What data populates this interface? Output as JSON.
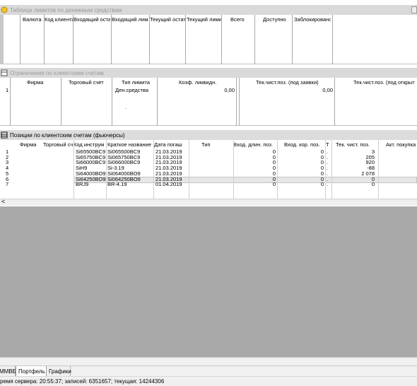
{
  "limits_window": {
    "title": "Таблица лимитов по денежным средствам",
    "columns": [
      "Валюта",
      "Код клиента",
      "Входящий остат",
      "Входящий лими",
      "Текущий остат",
      "Текущий лими",
      "Всего",
      "Доступно",
      "Заблокировано"
    ]
  },
  "restrictions_window": {
    "title": "Ограничения по клиентским счетам",
    "columns": [
      "Фирма",
      "Торговый счет",
      "Тип лимита",
      "Коэф. ликвидн.",
      "Тек.чист.поз. (под заявки)",
      "Тек.чист.поз. (под открыт"
    ],
    "row": {
      "num": "1",
      "limit_type": "Ден.средства",
      "coef": "0,00",
      "net_pos_orders": "0,00",
      "dot": "."
    }
  },
  "positions_window": {
    "title": "Позиции по клиентским счетам (фьючерсы)",
    "columns": [
      "Фирма",
      "Торговый сч",
      "Код инструм",
      "Краткое название",
      "Дата погаш",
      "Тип",
      "Вход. длин. поз.",
      "Вход. кор. поз.",
      "Т",
      "Тек. чист. поз.",
      "Акт. покупка"
    ],
    "rows": [
      {
        "num": "1",
        "code": "Si65500BC9",
        "short": "Si065500BC9",
        "date": "21.03.2019",
        "long": "0",
        "short_pos": "0",
        "t": ".",
        "net": "3"
      },
      {
        "num": "2",
        "code": "Si65750BC9",
        "short": "Si065750BC9",
        "date": "21.03.2019",
        "long": "0",
        "short_pos": "0",
        "t": ".",
        "net": "205"
      },
      {
        "num": "3",
        "code": "Si66000BC9",
        "short": "Si066000BC9",
        "date": "21.03.2019",
        "long": "0",
        "short_pos": "0",
        "t": ".",
        "net": "920"
      },
      {
        "num": "4",
        "code": "SiH9",
        "short": "Si-3.19",
        "date": "21.03.2019",
        "long": "0",
        "short_pos": "0",
        "t": ".",
        "net": "-88"
      },
      {
        "num": "5",
        "code": "Si64000BO9",
        "short": "Si064000BO9",
        "date": "21.03.2019",
        "long": "0",
        "short_pos": "0",
        "t": ".",
        "net": "2 078"
      },
      {
        "num": "6",
        "code": "Si64250BO9",
        "short": "Si064250BO9",
        "date": "21.03.2019",
        "long": "0",
        "short_pos": "0",
        "t": ".",
        "net": "0"
      },
      {
        "num": "7",
        "code": "BRJ9",
        "short": "BR-4.19",
        "date": "01.04.2019",
        "long": "0",
        "short_pos": "0",
        "t": ".",
        "net": "0"
      }
    ],
    "selected_row": "5"
  },
  "scroll_left_glyph": "<",
  "tabs": [
    "ММВБ",
    "Портфель",
    "Графики"
  ],
  "active_tab": "Портфель",
  "status_bar": "ремя сервера: 20:55:37; записей: 6351657; текущая: 14244306",
  "colors": {
    "title_bar": "#d9d9d9",
    "gray_area": "#a9a9a9",
    "selected_row": "#e6e6e6"
  }
}
